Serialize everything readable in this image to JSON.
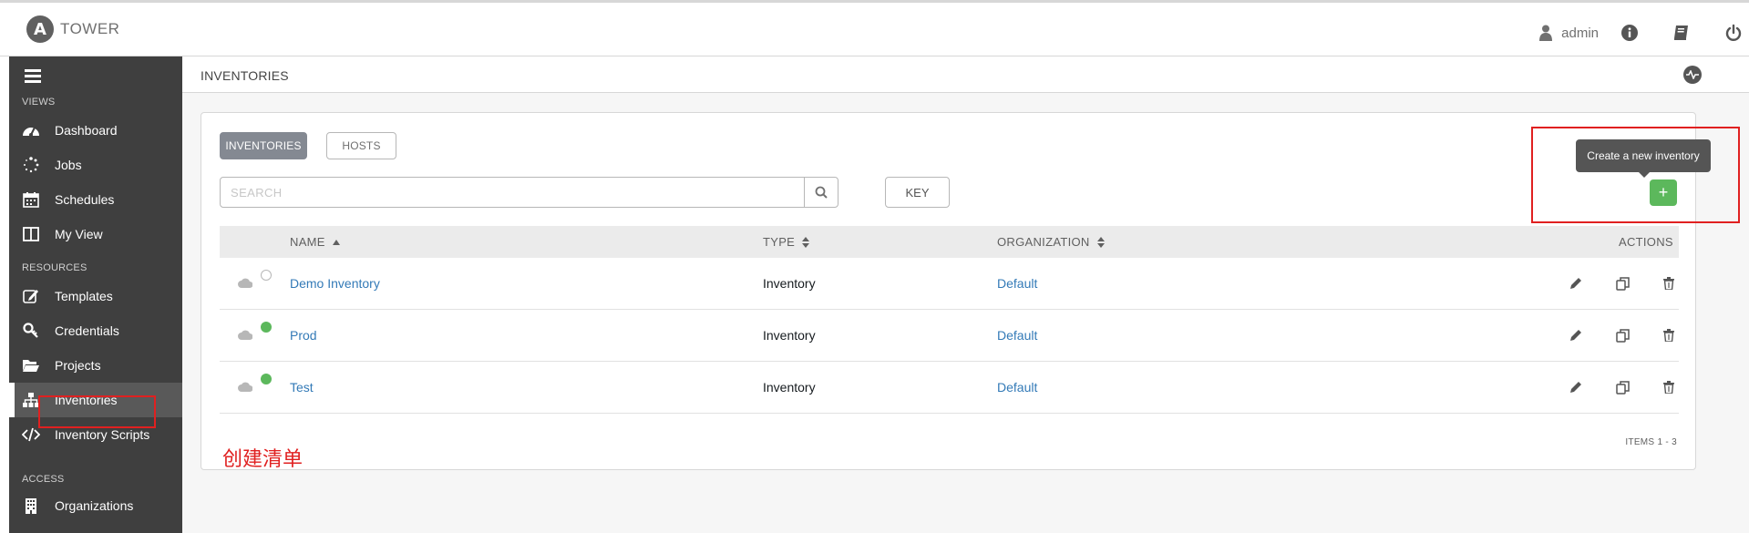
{
  "app": {
    "logo_letter": "A",
    "logo_text": "TOWER",
    "user": "admin"
  },
  "sidebar": {
    "sections": {
      "views": "VIEWS",
      "resources": "RESOURCES",
      "access": "ACCESS"
    },
    "items": [
      {
        "label": "Dashboard",
        "icon": "dashboard-icon"
      },
      {
        "label": "Jobs",
        "icon": "spinner-icon"
      },
      {
        "label": "Schedules",
        "icon": "calendar-icon"
      },
      {
        "label": "My View",
        "icon": "columns-icon"
      },
      {
        "label": "Templates",
        "icon": "pencil-square-icon"
      },
      {
        "label": "Credentials",
        "icon": "key-icon"
      },
      {
        "label": "Projects",
        "icon": "folder-open-icon"
      },
      {
        "label": "Inventories",
        "icon": "sitemap-icon",
        "active": true
      },
      {
        "label": "Inventory Scripts",
        "icon": "code-icon"
      },
      {
        "label": "Organizations",
        "icon": "building-icon"
      }
    ]
  },
  "breadcrumb": "INVENTORIES",
  "tabs": {
    "inventories": "INVENTORIES",
    "hosts": "HOSTS"
  },
  "search": {
    "placeholder": "SEARCH",
    "key_label": "KEY"
  },
  "add_button": {
    "label": "+",
    "tooltip": "Create a new inventory"
  },
  "table": {
    "columns": {
      "name": "NAME",
      "type": "TYPE",
      "organization": "ORGANIZATION",
      "actions": "ACTIONS"
    },
    "rows": [
      {
        "name": "Demo Inventory",
        "type": "Inventory",
        "organization": "Default",
        "status": "none"
      },
      {
        "name": "Prod",
        "type": "Inventory",
        "organization": "Default",
        "status": "ok"
      },
      {
        "name": "Test",
        "type": "Inventory",
        "organization": "Default",
        "status": "ok"
      }
    ],
    "items_label": "ITEMS  1 - 3"
  },
  "annotation": "创建清单",
  "colors": {
    "sidebar": "#3f3f3f",
    "accent_green": "#5cb85c",
    "link": "#337ab7",
    "annotation_red": "#e02020"
  }
}
